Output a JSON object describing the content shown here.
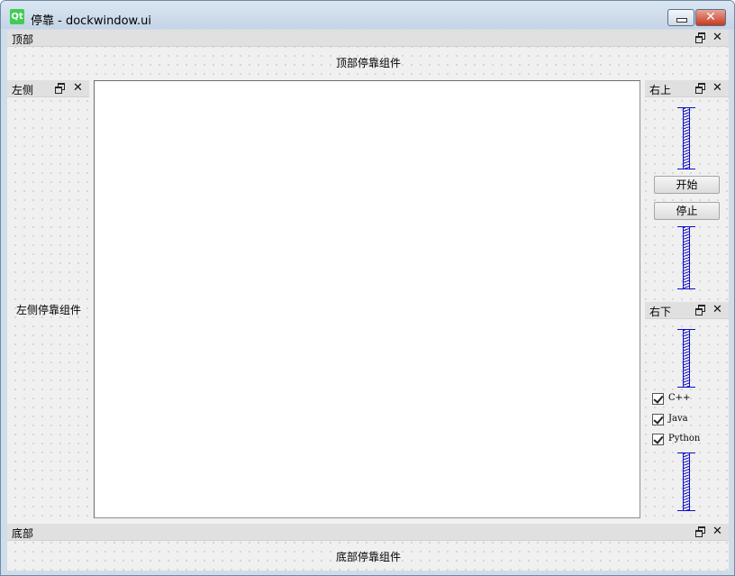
{
  "window": {
    "title": "停靠 - dockwindow.ui",
    "icon": "qt-logo-icon",
    "icon_text": "Qt",
    "close_glyph": "✕"
  },
  "dock_controls": {
    "close_glyph": "✕"
  },
  "docks": {
    "top": {
      "title": "顶部",
      "content": "顶部停靠组件"
    },
    "left": {
      "title": "左侧",
      "content": "左侧停靠组件"
    },
    "right_top": {
      "title": "右上",
      "buttons": {
        "start": "开始",
        "stop": "停止"
      }
    },
    "right_bottom": {
      "title": "右下",
      "checkboxes": [
        {
          "label": "C++",
          "checked": true
        },
        {
          "label": "Java",
          "checked": true
        },
        {
          "label": "Python",
          "checked": true
        }
      ]
    },
    "bottom": {
      "title": "底部",
      "content": "底部停靠组件"
    }
  },
  "colors": {
    "spacer": "#1010c8",
    "qt_green": "#41cd52",
    "close_red": "#c63a1f"
  }
}
